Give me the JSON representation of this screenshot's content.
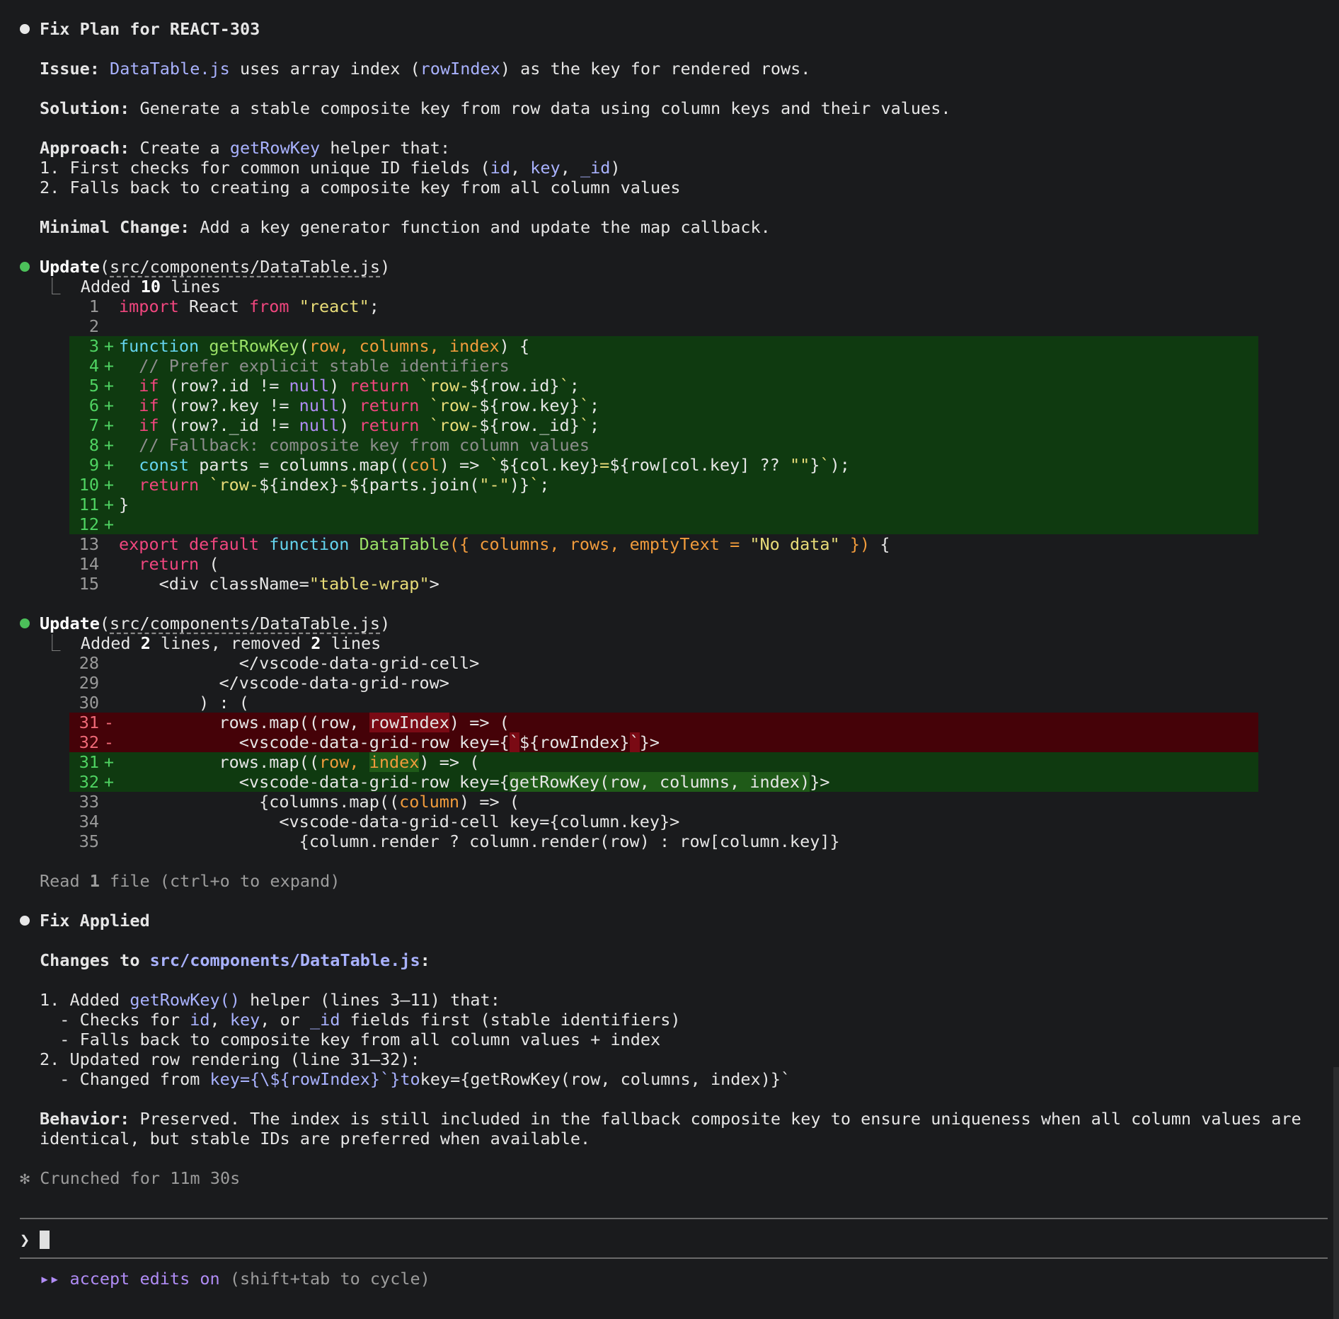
{
  "plan": {
    "title": "Fix Plan for REACT-303",
    "issue_label": "Issue:",
    "issue_file": "DataTable.js",
    "issue_t1": " uses array index (",
    "issue_var": "rowIndex",
    "issue_t2": ") as the key for rendered rows.",
    "solution_label": "Solution:",
    "solution_text": " Generate a stable composite key from row data using column keys and their values.",
    "approach_label": "Approach:",
    "approach_t1": " Create a ",
    "approach_fn": "getRowKey",
    "approach_t2": " helper that:",
    "step1_t1": "1. First checks for common unique ID fields (",
    "step1_id": "id",
    "step1_sep1": ", ",
    "step1_key": "key",
    "step1_sep2": ", ",
    "step1_uid": "_id",
    "step1_t2": ")",
    "step2": "2. Falls back to creating a composite key from all column values",
    "minimal_label": "Minimal Change:",
    "minimal_text": " Add a key generator function and update the map callback."
  },
  "update1": {
    "tool": "Update",
    "path": "src/components/DataTable.js",
    "summary_t1": "Added ",
    "summary_n": "10",
    "summary_t2": " lines"
  },
  "update2": {
    "tool": "Update",
    "path": "src/components/DataTable.js",
    "summary_t1": "Added ",
    "summary_n1": "2",
    "summary_t2": " lines, removed ",
    "summary_n2": "2",
    "summary_t3": " lines"
  },
  "read": {
    "t1": "Read ",
    "n": "1",
    "t2": " file (ctrl+o to expand)"
  },
  "applied": {
    "title": "Fix Applied",
    "changes_label": "Changes to ",
    "changes_file": "src/components/DataTable.js",
    "changes_colon": ":",
    "l1_t1": "1. Added ",
    "l1_fn": "getRowKey()",
    "l1_t2": " helper (lines 3–11) that:",
    "l2_t1": "  - Checks for ",
    "l2_id": "id",
    "l2_sep1": ", ",
    "l2_key": "key",
    "l2_sep2": ", or ",
    "l2_uid": "_id",
    "l2_t2": " fields first (stable identifiers)",
    "l3": "  - Falls back to composite key from all column values + index",
    "l4": "2. Updated row rendering (line 31–32):",
    "l5_t1": "  - Changed from ",
    "l5_code1": "key={\\${rowIndex}`}",
    "l5_to": "to",
    "l5_code2": "key={getRowKey(row, columns, index)}`",
    "behavior_label": "Behavior:",
    "behavior_t1": " Preserved. The index is still included in the fallback composite key to ensure uniqueness when all column values are",
    "behavior_t2": "identical, but stable IDs are preferred when available."
  },
  "status": {
    "star": "✻",
    "text": " Crunched for 11m 30s"
  },
  "prompt": {
    "chevron": "❯"
  },
  "footer": {
    "arrows": "▸▸",
    "mode": " accept edits on",
    "hint": " (shift+tab to cycle)"
  }
}
